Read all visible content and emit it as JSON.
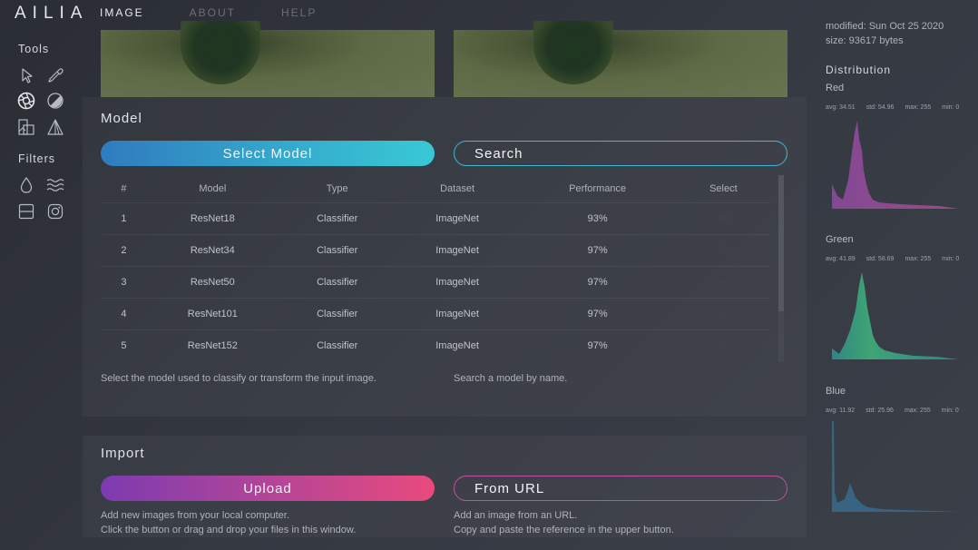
{
  "app": {
    "logo": "AILIA"
  },
  "nav": {
    "items": [
      "IMAGE",
      "ABOUT",
      "HELP"
    ],
    "active": 0
  },
  "sidebar": {
    "tools_title": "Tools",
    "filters_title": "Filters",
    "tools": [
      "cursor-icon",
      "eyedropper-icon",
      "aperture-icon",
      "contrast-icon",
      "crop-icon",
      "triangle-icon"
    ],
    "filters": [
      "drop-icon",
      "waves-icon",
      "layers-icon",
      "instagram-icon"
    ]
  },
  "model_section": {
    "title": "Model",
    "select_label": "Select Model",
    "search_label": "Search",
    "columns": [
      "#",
      "Model",
      "Type",
      "Dataset",
      "Performance",
      "Select"
    ],
    "rows": [
      {
        "num": "1",
        "model": "ResNet18",
        "type": "Classifier",
        "dataset": "ImageNet",
        "perf": "93%"
      },
      {
        "num": "2",
        "model": "ResNet34",
        "type": "Classifier",
        "dataset": "ImageNet",
        "perf": "97%"
      },
      {
        "num": "3",
        "model": "ResNet50",
        "type": "Classifier",
        "dataset": "ImageNet",
        "perf": "97%"
      },
      {
        "num": "4",
        "model": "ResNet101",
        "type": "Classifier",
        "dataset": "ImageNet",
        "perf": "97%"
      },
      {
        "num": "5",
        "model": "ResNet152",
        "type": "Classifier",
        "dataset": "ImageNet",
        "perf": "97%"
      }
    ],
    "hint_left": "Select the model used to classify or transform the input image.",
    "hint_right": "Search a model by name."
  },
  "import_section": {
    "title": "Import",
    "upload_label": "Upload",
    "url_label": "From URL",
    "hint_left_1": "Add new images from your local computer.",
    "hint_left_2": "Click the button or drag and drop your files in this window.",
    "hint_right_1": "Add an image from an URL.",
    "hint_right_2": "Copy and paste the reference in the upper button."
  },
  "info": {
    "modified": "modified: Sun Oct 25 2020",
    "size": "size: 93617 bytes"
  },
  "distribution": {
    "title": "Distribution",
    "channels": [
      {
        "name": "Red",
        "avg": "avg: 34.51",
        "std": "std: 54.96",
        "max": "max: 255",
        "min": "min: 0",
        "color": "#8a4a9e"
      },
      {
        "name": "Green",
        "avg": "avg: 41.89",
        "std": "std: 58.69",
        "max": "max: 255",
        "min": "min: 0",
        "color": "#3aa07e"
      },
      {
        "name": "Blue",
        "avg": "avg: 11.92",
        "std": "std: 25.96",
        "max": "max: 255",
        "min": "min: 0",
        "color": "#3a6a8e"
      }
    ]
  }
}
